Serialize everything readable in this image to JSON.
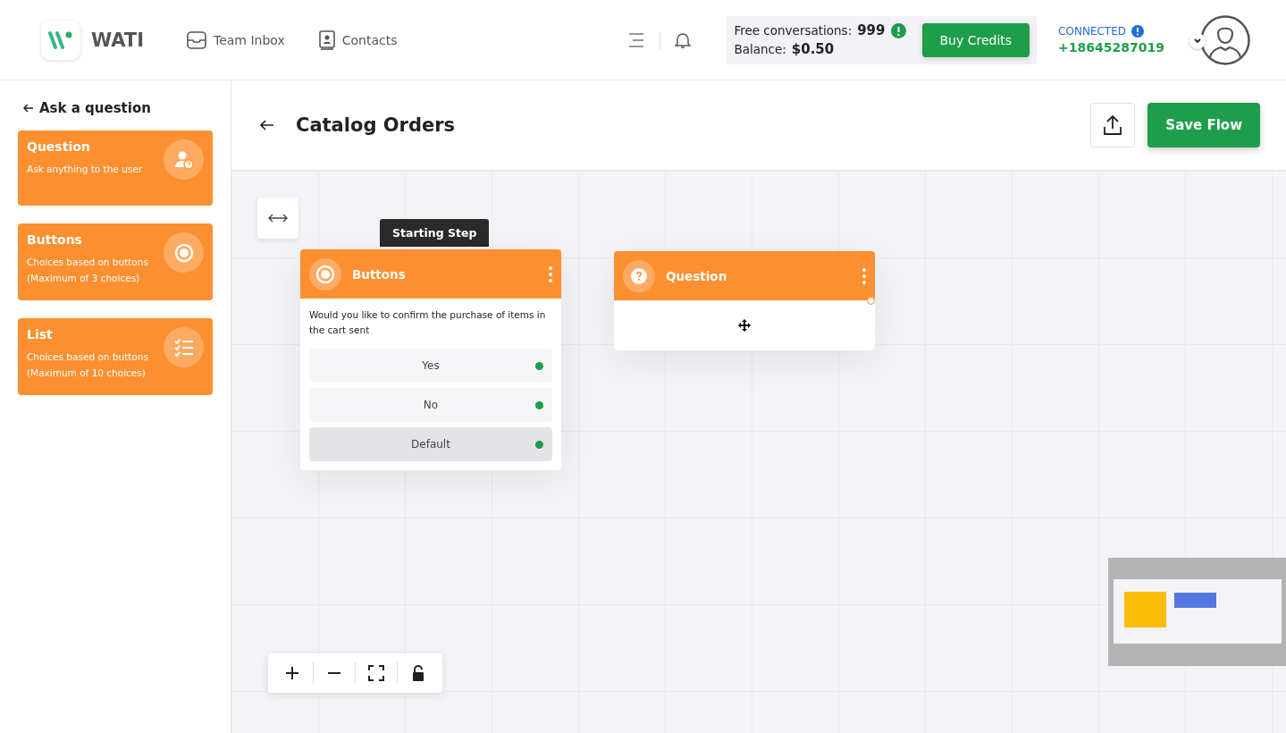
{
  "header": {
    "logo_text": "WATI",
    "nav": [
      {
        "label": "Team Inbox",
        "kind": "inbox"
      },
      {
        "label": "Contacts",
        "kind": "contacts"
      }
    ],
    "credits": {
      "free_label": "Free conversations:",
      "free_value": "999",
      "balance_label": "Balance:",
      "balance_value": "$0.50",
      "button": "Buy Credits"
    },
    "connection": {
      "status": "CONNECTED",
      "phone": "+18645287019"
    }
  },
  "sidebar": {
    "back_label": "Ask a question",
    "cards": [
      {
        "title": "Question",
        "description": "Ask anything to the user",
        "kind": "question"
      },
      {
        "title": "Buttons",
        "description": "Choices based on buttons (Maximum of 3 choices)",
        "kind": "buttons"
      },
      {
        "title": "List",
        "description": "Choices based on buttons (Maximum of 10 choices)",
        "kind": "list"
      }
    ]
  },
  "page": {
    "title": "Catalog Orders",
    "save_button": "Save Flow"
  },
  "canvas": {
    "start_tag": "Starting Step",
    "nodes": [
      {
        "title": "Buttons",
        "kind": "buttons",
        "body": "Would you like to confirm the purchase of items in the cart sent",
        "options": [
          {
            "label": "Yes",
            "kind": "button"
          },
          {
            "label": "No",
            "kind": "button"
          },
          {
            "label": "Default",
            "kind": "default"
          }
        ]
      },
      {
        "title": "Question",
        "kind": "question"
      }
    ]
  }
}
